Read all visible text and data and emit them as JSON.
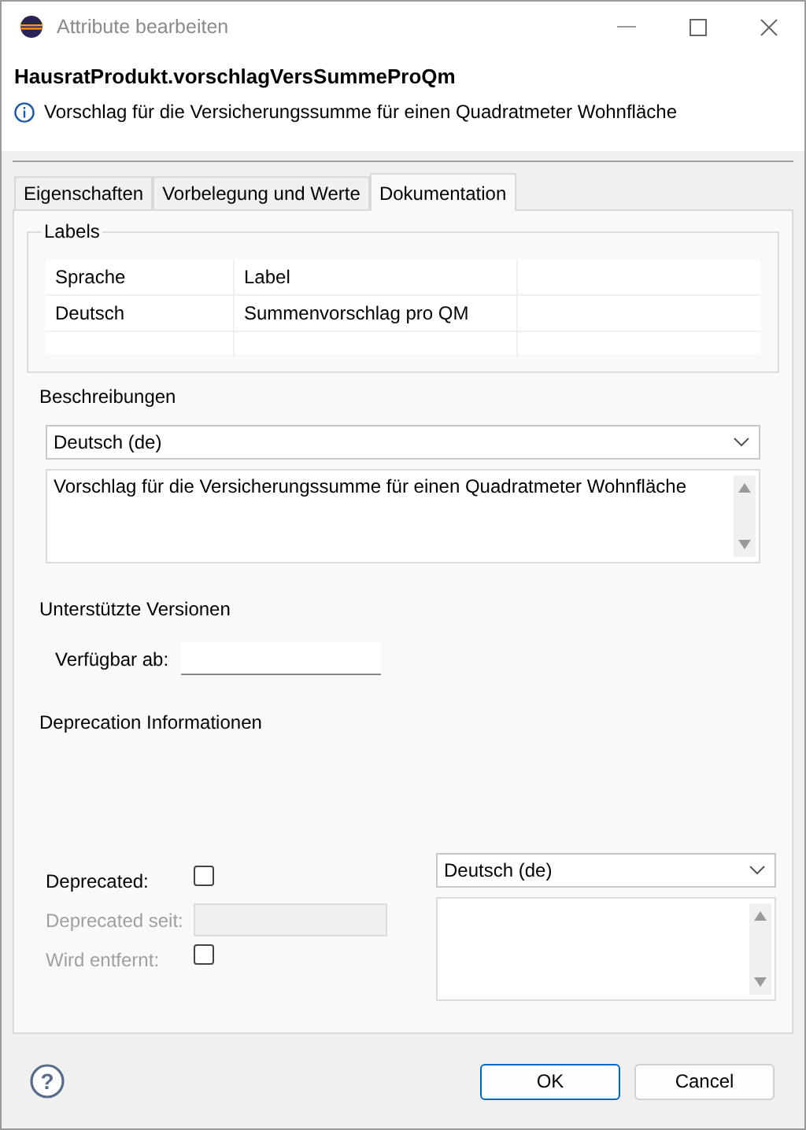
{
  "window": {
    "title": "Attribute bearbeiten"
  },
  "header": {
    "title": "HausratProdukt.vorschlagVersSummeProQm",
    "message": "Vorschlag für die Versicherungssumme für einen Quadratmeter Wohnfläche"
  },
  "tabs": [
    {
      "label": "Eigenschaften",
      "selected": false
    },
    {
      "label": "Vorbelegung und Werte",
      "selected": false
    },
    {
      "label": "Dokumentation",
      "selected": true
    }
  ],
  "labels": {
    "title": "Labels",
    "columns": [
      "Sprache",
      "Label"
    ],
    "rows": [
      [
        "Deutsch",
        "Summenvorschlag pro QM"
      ]
    ]
  },
  "descriptions": {
    "title": "Beschreibungen",
    "language": "Deutsch (de)",
    "text": "Vorschlag für die Versicherungssumme für einen Quadratmeter Wohnfläche"
  },
  "versions": {
    "title": "Unterstützte Versionen",
    "available_from_label": "Verfügbar ab:"
  },
  "deprecation": {
    "title": "Deprecation Informationen",
    "language": "Deutsch (de)",
    "fields": [
      {
        "kind": "checkbox",
        "label": "Deprecated:",
        "checked": false,
        "disabled": false
      },
      {
        "kind": "input",
        "label": "Deprecated seit:",
        "disabled": true
      },
      {
        "kind": "checkbox",
        "label": "Wird entfernt:",
        "checked": false,
        "disabled": true
      }
    ]
  },
  "help": {
    "symbol": "?"
  },
  "buttons": [
    {
      "label": "OK",
      "default": true
    },
    {
      "label": "Cancel",
      "default": false
    }
  ]
}
